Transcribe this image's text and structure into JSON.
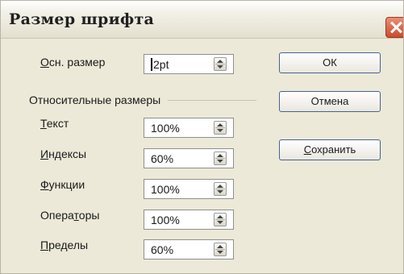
{
  "window": {
    "title": "Размер шрифта"
  },
  "base_size": {
    "label_accel": "О",
    "label_rest": "сн. размер",
    "value": "12pt",
    "value_text": "2pt"
  },
  "relative_group": {
    "title": "Относительные размеры"
  },
  "rows": [
    {
      "accel": "Т",
      "rest": "екст",
      "value": "100%"
    },
    {
      "accel": "И",
      "rest": "ндексы",
      "value": "60%"
    },
    {
      "accel": "Ф",
      "rest": "ункции",
      "value": "100%"
    },
    {
      "pre": "Опера",
      "accel": "т",
      "rest": "оры",
      "value": "100%"
    },
    {
      "accel": "П",
      "rest": "ределы",
      "value": "60%"
    }
  ],
  "buttons": {
    "ok": "ОК",
    "cancel": "Отмена",
    "save_accel": "С",
    "save_rest": "охранить"
  }
}
